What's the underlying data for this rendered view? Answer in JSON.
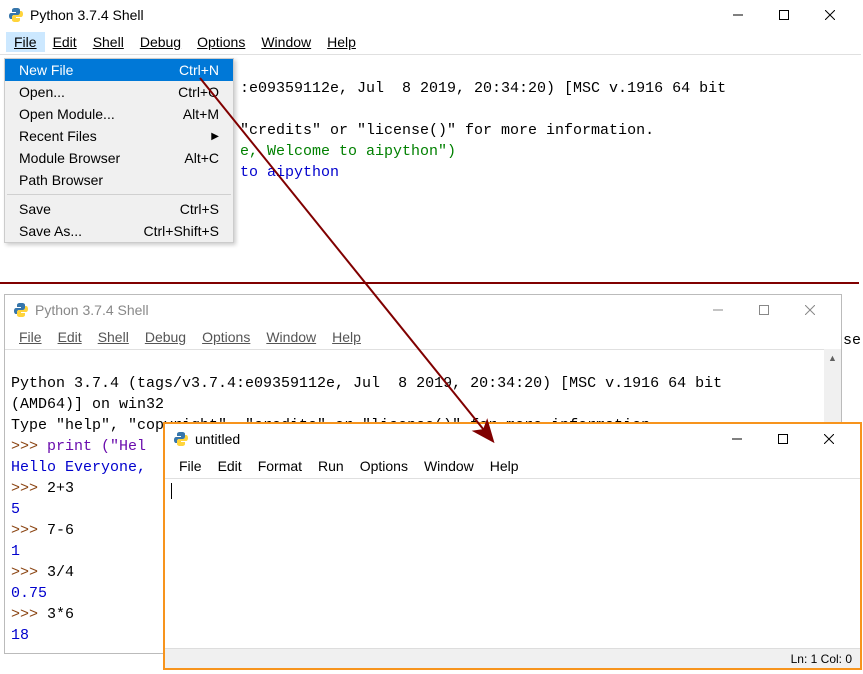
{
  "win1": {
    "title": "Python 3.7.4 Shell",
    "menus": [
      "File",
      "Edit",
      "Shell",
      "Debug",
      "Options",
      "Window",
      "Help"
    ],
    "content_visible": {
      "line1_suffix": ":e09359112e, Jul  8 2019, 20:34:20) [MSC v.1916 64 bit",
      "line3_suffix": "\"credits\" or \"license()\" for more information.",
      "line4_suffix": "e, Welcome to aipython\")",
      "line5_suffix": "to aipython"
    },
    "dropdown": [
      {
        "label": "New File",
        "accel": "Ctrl+N",
        "selected": true
      },
      {
        "label": "Open...",
        "accel": "Ctrl+O"
      },
      {
        "label": "Open Module...",
        "accel": "Alt+M"
      },
      {
        "label": "Recent Files",
        "sub": true
      },
      {
        "label": "Module Browser",
        "accel": "Alt+C"
      },
      {
        "label": "Path Browser"
      },
      {
        "sep": true
      },
      {
        "label": "Save",
        "accel": "Ctrl+S"
      },
      {
        "label": "Save As...",
        "accel": "Ctrl+Shift+S"
      }
    ]
  },
  "win2": {
    "title": "Python 3.7.4 Shell",
    "menus": [
      "File",
      "Edit",
      "Shell",
      "Debug",
      "Options",
      "Window",
      "Help"
    ],
    "lines": {
      "l1": "Python 3.7.4 (tags/v3.7.4:e09359112e, Jul  8 2019, 20:34:20) [MSC v.1916 64 bit",
      "l2": "(AMD64)] on win32",
      "l3": "Type \"help\", \"copyright\", \"credits\" or \"license()\" for more information.",
      "p1": ">>> ",
      "p1code": "print (\"Hel",
      "out1": "Hello Everyone,",
      "p2": ">>> ",
      "p2code": "2+3",
      "out2": "5",
      "p3": ">>> ",
      "p3code": "7-6",
      "out3": "1",
      "p4": ">>> ",
      "p4code": "3/4",
      "out4": "0.75",
      "p5": ">>> ",
      "p5code": "3*6",
      "out5": "18",
      "p6": ">>> "
    }
  },
  "win3": {
    "title": "untitled",
    "menus": [
      "File",
      "Edit",
      "Format",
      "Run",
      "Options",
      "Window",
      "Help"
    ],
    "status": "Ln: 1  Col: 0"
  },
  "trunc": "se"
}
